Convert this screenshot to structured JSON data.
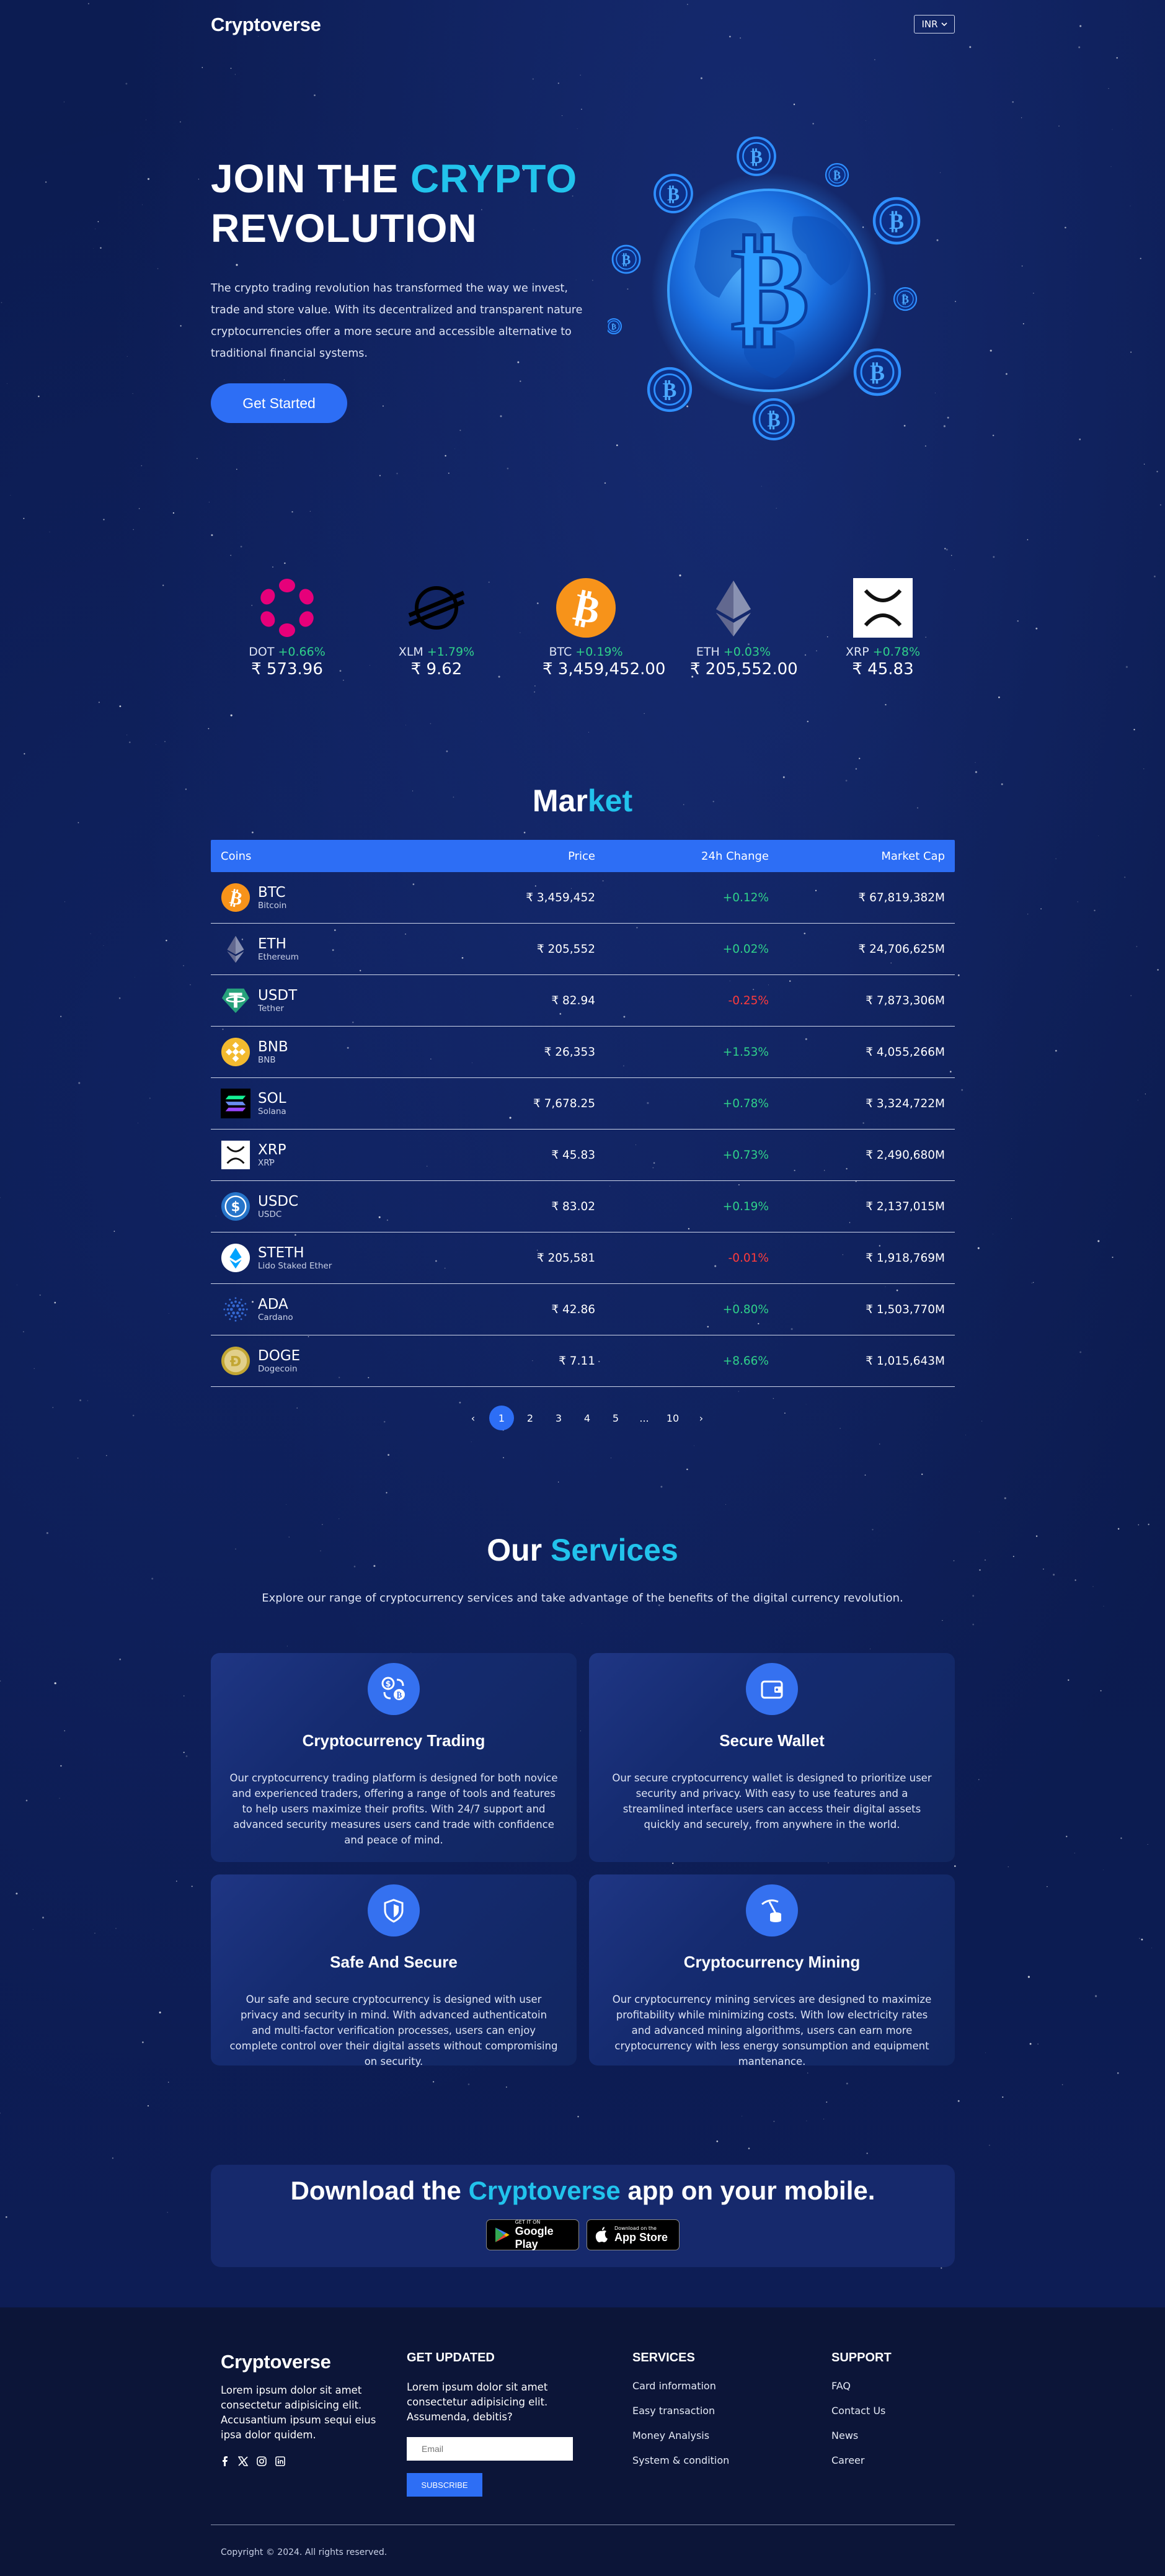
{
  "header": {
    "logo": "Cryptoverse",
    "currency": "INR"
  },
  "hero": {
    "title_part1": "JOIN THE",
    "title_highlight": "CRYPTO",
    "title_part2": "REVOLUTION",
    "description": "The crypto trading revolution has transformed the way we invest, trade and store value. With its decentralized and transparent nature cryptocurrencies offer a more secure and accessible alternative to traditional financial systems.",
    "cta": "Get Started"
  },
  "ticker": [
    {
      "symbol": "DOT",
      "change": "+0.66%",
      "price": "₹ 573.96",
      "icon": "polkadot-icon"
    },
    {
      "symbol": "XLM",
      "change": "+1.79%",
      "price": "₹ 9.62",
      "icon": "stellar-icon"
    },
    {
      "symbol": "BTC",
      "change": "+0.19%",
      "price": "₹ 3,459,452.00",
      "icon": "bitcoin-icon"
    },
    {
      "symbol": "ETH",
      "change": "+0.03%",
      "price": "₹ 205,552.00",
      "icon": "ethereum-icon"
    },
    {
      "symbol": "XRP",
      "change": "+0.78%",
      "price": "₹ 45.83",
      "icon": "xrp-icon"
    }
  ],
  "market": {
    "title_part1": "Mar",
    "title_highlight": "ket",
    "headers": {
      "coins": "Coins",
      "price": "Price",
      "change": "24h Change",
      "cap": "Market Cap"
    },
    "rows": [
      {
        "symbol": "BTC",
        "name": "Bitcoin",
        "price": "₹ 3,459,452",
        "change": "+0.12%",
        "cap": "₹ 67,819,382M",
        "up": true,
        "icon": "bitcoin-icon",
        "color": "#f7931a"
      },
      {
        "symbol": "ETH",
        "name": "Ethereum",
        "price": "₹ 205,552",
        "change": "+0.02%",
        "cap": "₹ 24,706,625M",
        "up": true,
        "icon": "ethereum-icon",
        "color": "#8a92b2"
      },
      {
        "symbol": "USDT",
        "name": "Tether",
        "price": "₹ 82.94",
        "change": "-0.25%",
        "cap": "₹ 7,873,306M",
        "up": false,
        "icon": "tether-icon",
        "color": "#26a17b"
      },
      {
        "symbol": "BNB",
        "name": "BNB",
        "price": "₹ 26,353",
        "change": "+1.53%",
        "cap": "₹ 4,055,266M",
        "up": true,
        "icon": "bnb-icon",
        "color": "#f3ba2f"
      },
      {
        "symbol": "SOL",
        "name": "Solana",
        "price": "₹ 7,678.25",
        "change": "+0.78%",
        "cap": "₹ 3,324,722M",
        "up": true,
        "icon": "solana-icon",
        "color": "#000000"
      },
      {
        "symbol": "XRP",
        "name": "XRP",
        "price": "₹ 45.83",
        "change": "+0.73%",
        "cap": "₹ 2,490,680M",
        "up": true,
        "icon": "xrp-icon",
        "color": "#ffffff"
      },
      {
        "symbol": "USDC",
        "name": "USDC",
        "price": "₹ 83.02",
        "change": "+0.19%",
        "cap": "₹ 2,137,015M",
        "up": true,
        "icon": "usdc-icon",
        "color": "#2775ca"
      },
      {
        "symbol": "STETH",
        "name": "Lido Staked Ether",
        "price": "₹ 205,581",
        "change": "-0.01%",
        "cap": "₹ 1,918,769M",
        "up": false,
        "icon": "steth-icon",
        "color": "#ffffff"
      },
      {
        "symbol": "ADA",
        "name": "Cardano",
        "price": "₹ 42.86",
        "change": "+0.80%",
        "cap": "₹ 1,503,770M",
        "up": true,
        "icon": "cardano-icon",
        "color": "#0033ad"
      },
      {
        "symbol": "DOGE",
        "name": "Dogecoin",
        "price": "₹ 7.11",
        "change": "+8.66%",
        "cap": "₹ 1,015,643M",
        "up": true,
        "icon": "dogecoin-icon",
        "color": "#c2a633"
      }
    ],
    "pagination": {
      "prev": "‹",
      "pages": [
        "1",
        "2",
        "3",
        "4",
        "5"
      ],
      "ellipsis": "...",
      "last": "10",
      "next": "›",
      "current": "1"
    }
  },
  "services": {
    "title_part1": "Our",
    "title_highlight": "Services",
    "subtitle": "Explore our range of cryptocurrency services and take advantage of the benefits of the digital currency revolution.",
    "cards": [
      {
        "title": "Cryptocurrency Trading",
        "icon": "exchange-icon",
        "text": "Our cryptocurrency trading platform is designed for both novice and experienced traders, offering a range of tools and features to help users maximize their profits. With 24/7 support and advanced security measures users cand trade with confidence and peace of mind."
      },
      {
        "title": "Secure Wallet",
        "icon": "wallet-icon",
        "text": "Our secure cryptocurrency wallet is designed to prioritize user security and privacy. With easy to use features and a streamlined interface users can access their digital assets quickly and securely, from anywhere in the world."
      },
      {
        "title": "Safe And Secure",
        "icon": "shield-icon",
        "text": "Our safe and secure cryptocurrency is designed with user privacy and security in mind. With advanced authenticatoin and multi-factor verification processes, users can enjoy complete control over their digital assets without compromising on security."
      },
      {
        "title": "Cryptocurrency Mining",
        "icon": "mining-icon",
        "text": "Our cryptocurrency mining services are designed to maximize profitability while minimizing costs. With low electricity rates and advanced mining algorithms, users can earn more cryptocurrency with less energy sonsumption and equipment mantenance."
      }
    ]
  },
  "download": {
    "title_part1": "Download the",
    "title_highlight": "Cryptoverse",
    "title_part2": "app on your mobile.",
    "google_small": "GET IT ON",
    "google_big": "Google Play",
    "apple_small": "Download on the",
    "apple_big": "App Store"
  },
  "footer": {
    "logo": "Cryptoverse",
    "description": "Lorem ipsum dolor sit amet consectetur adipisicing elit. Accusantium ipsum sequi eius ipsa dolor quidem.",
    "updated_title": "GET UPDATED",
    "updated_text": "Lorem ipsum dolor sit amet consectetur adipisicing elit. Assumenda, debitis?",
    "email_placeholder": "Email",
    "subscribe": "SUBSCRIBE",
    "services_title": "SERVICES",
    "services_links": [
      "Card information",
      "Easy transaction",
      "Money Analysis",
      "System & condition"
    ],
    "support_title": "SUPPORT",
    "support_links": [
      "FAQ",
      "Contact Us",
      "News",
      "Career"
    ],
    "copyright": "Copyright © 2024. All rights reserved."
  },
  "colors": {
    "accent": "#2d6ef5",
    "highlight": "#22c3ec",
    "positive": "#2fd18a",
    "negative": "#ff3b3b",
    "background": "#0b1a4a"
  }
}
